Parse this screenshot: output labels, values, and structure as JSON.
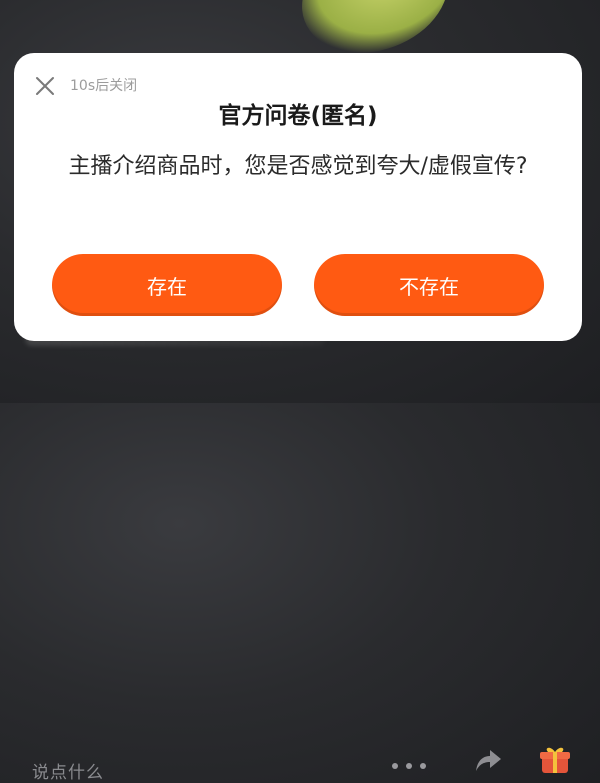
{
  "dialog": {
    "countdown": "10s后关闭",
    "title": "官方问卷(匿名)",
    "question": "主播介绍商品时，您是否感觉到夸大/虚假宣传?",
    "options": [
      "存在",
      "不存在"
    ]
  },
  "bottom_bar": {
    "comment_placeholder": "说点什么"
  },
  "colors": {
    "button": "#ff5a12",
    "background": "#2a2b2e"
  }
}
